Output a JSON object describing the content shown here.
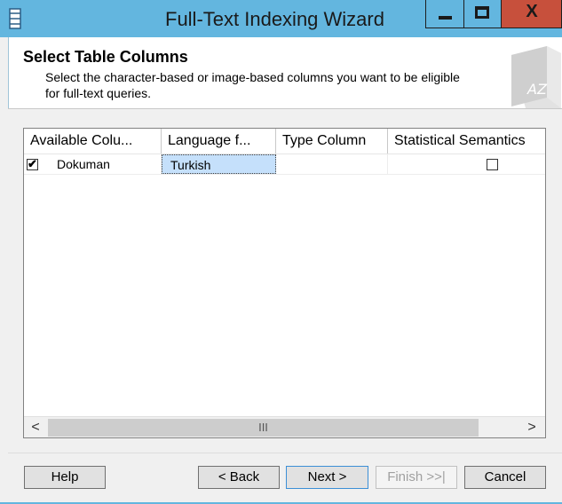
{
  "window": {
    "title": "Full-Text Indexing Wizard",
    "close_glyph": "X"
  },
  "header": {
    "title": "Select Table Columns",
    "description": "Select the character-based or image-based columns you want to be eligible for full-text queries.",
    "art_text": "AZ"
  },
  "grid": {
    "columns": [
      "Available Colu...",
      "Language f...",
      "Type Column",
      "Statistical Semantics"
    ],
    "rows": [
      {
        "checked": true,
        "column": "Dokuman",
        "language": "Turkish",
        "type_column": "",
        "statistical_semantics": false
      }
    ],
    "scroll_thumb_glyph": "III",
    "scroll_left_glyph": "<",
    "scroll_right_glyph": ">"
  },
  "footer": {
    "help_label": "Help",
    "back_label": "< Back",
    "next_label": "Next >",
    "finish_label": "Finish >>|",
    "cancel_label": "Cancel"
  },
  "colors": {
    "titlebar": "#63b6df",
    "close_button": "#c7503c",
    "selection": "#c5e0fb"
  }
}
